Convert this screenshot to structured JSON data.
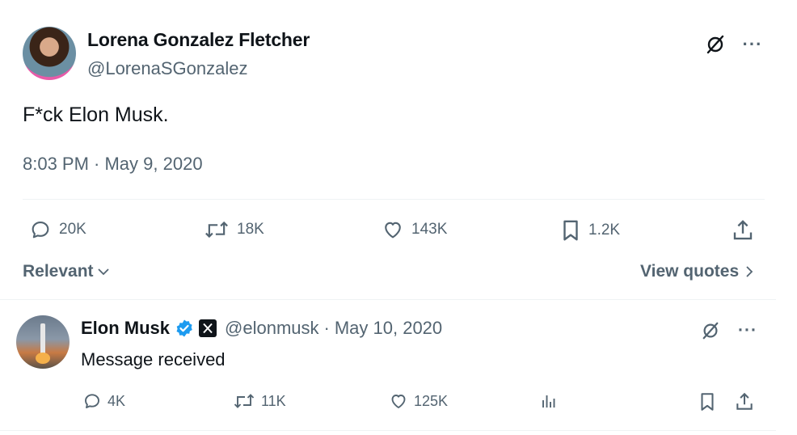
{
  "tweet": {
    "author_name": "Lorena Gonzalez Fletcher",
    "author_handle": "@LorenaSGonzalez",
    "text": "F*ck Elon Musk.",
    "timestamp": "8:03 PM · May 9, 2020",
    "stats": {
      "replies": "20K",
      "reposts": "18K",
      "likes": "143K",
      "bookmarks": "1.2K"
    },
    "more_label": "···"
  },
  "replies_bar": {
    "sort_label": "Relevant",
    "view_quotes_label": "View quotes"
  },
  "reply": {
    "author_name": "Elon Musk",
    "author_handle": "@elonmusk",
    "date": "May 10, 2020",
    "separator": "·",
    "text": "Message received",
    "stats": {
      "replies": "4K",
      "reposts": "11K",
      "likes": "125K"
    },
    "more_label": "···"
  },
  "colors": {
    "text_primary": "#0f1419",
    "text_secondary": "#536471",
    "verified_blue": "#1d9bf0",
    "divider": "#eff3f4"
  },
  "icons": [
    "grok-icon",
    "more-icon",
    "reply-icon",
    "repost-icon",
    "like-icon",
    "bookmark-icon",
    "share-icon",
    "views-icon",
    "verified-badge-icon",
    "x-logo-icon",
    "chevron-down-icon",
    "chevron-right-icon"
  ]
}
